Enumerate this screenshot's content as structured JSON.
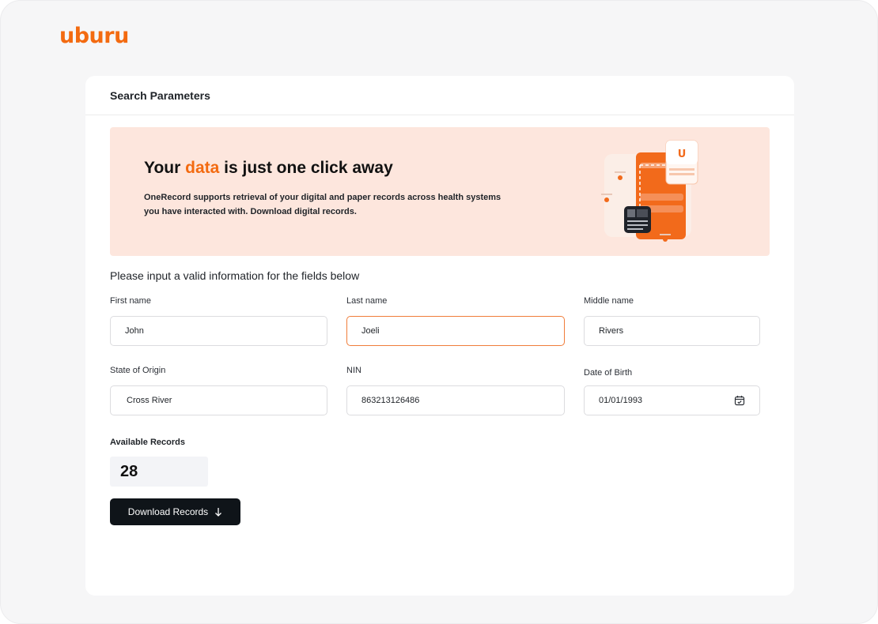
{
  "brand": {
    "logo_text": "uburu",
    "accent_color": "#f36a10"
  },
  "card": {
    "title": "Search Parameters"
  },
  "hero": {
    "title_before": "Your ",
    "title_accent": "data",
    "title_after": " is just one click away",
    "description": "OneRecord supports retrieval of your digital and paper records across health systems you have interacted with. Download digital records.",
    "illustration_logo": "U"
  },
  "form": {
    "instruction": "Please input a valid information for the fields below",
    "first_name": {
      "label": "First name",
      "value": "John"
    },
    "last_name": {
      "label": "Last name",
      "value": "Joeli"
    },
    "middle_name": {
      "label": "Middle name",
      "value": "Rivers"
    },
    "state_of_origin": {
      "label": "State of Origin",
      "value": "Cross River"
    },
    "nin": {
      "label": "NIN",
      "value": "863213126486"
    },
    "date_of_birth": {
      "label": "Date of Birth",
      "value": "01/01/1993",
      "icon": "calendar-icon"
    }
  },
  "records": {
    "label": "Available Records",
    "count": "28"
  },
  "actions": {
    "download_label": "Download Records",
    "download_icon": "arrow-down-icon"
  }
}
